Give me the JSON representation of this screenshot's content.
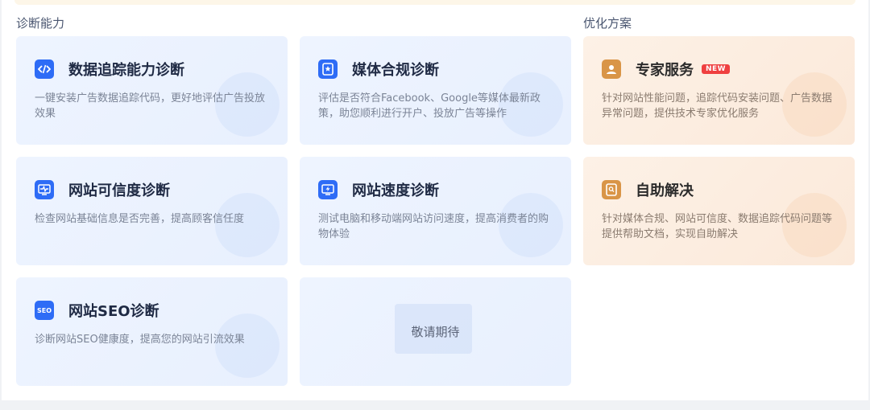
{
  "sections": {
    "diagnosis": "诊断能力",
    "optimize": "优化方案"
  },
  "cards": [
    {
      "title": "数据追踪能力诊断",
      "desc": "一键安装广告数据追踪代码，更好地评估广告投放效果",
      "icon": "code-icon"
    },
    {
      "title": "媒体合规诊断",
      "desc": "评估是否符合Facebook、Google等媒体最新政策，助您顺利进行开户、投放广告等操作",
      "icon": "compliance-icon"
    },
    {
      "title": "网站可信度诊断",
      "desc": "检查网站基础信息是否完善，提高顾客信任度",
      "icon": "monitor-pulse-icon"
    },
    {
      "title": "网站速度诊断",
      "desc": "测试电脑和移动端网站访问速度，提高消费者的购物体验",
      "icon": "lightning-monitor-icon"
    },
    {
      "title": "网站SEO诊断",
      "desc": "诊断网站SEO健康度，提高您的网站引流效果",
      "icon": "seo-icon",
      "icon_text": "SEO"
    }
  ],
  "coming_soon": "敬请期待",
  "optimize_cards": [
    {
      "title": "专家服务",
      "badge": "NEW",
      "desc": "针对网站性能问题，追踪代码安装问题、广告数据异常问题，提供技术专家优化服务",
      "icon": "expert-icon"
    },
    {
      "title": "自助解决",
      "desc": "针对媒体合规、网站可信度、数据追踪代码问题等提供帮助文档，实现自助解决",
      "icon": "document-search-icon"
    }
  ],
  "colors": {
    "accent": "#2e6cf6",
    "orange": "#d99547",
    "badge": "#ef4040"
  }
}
